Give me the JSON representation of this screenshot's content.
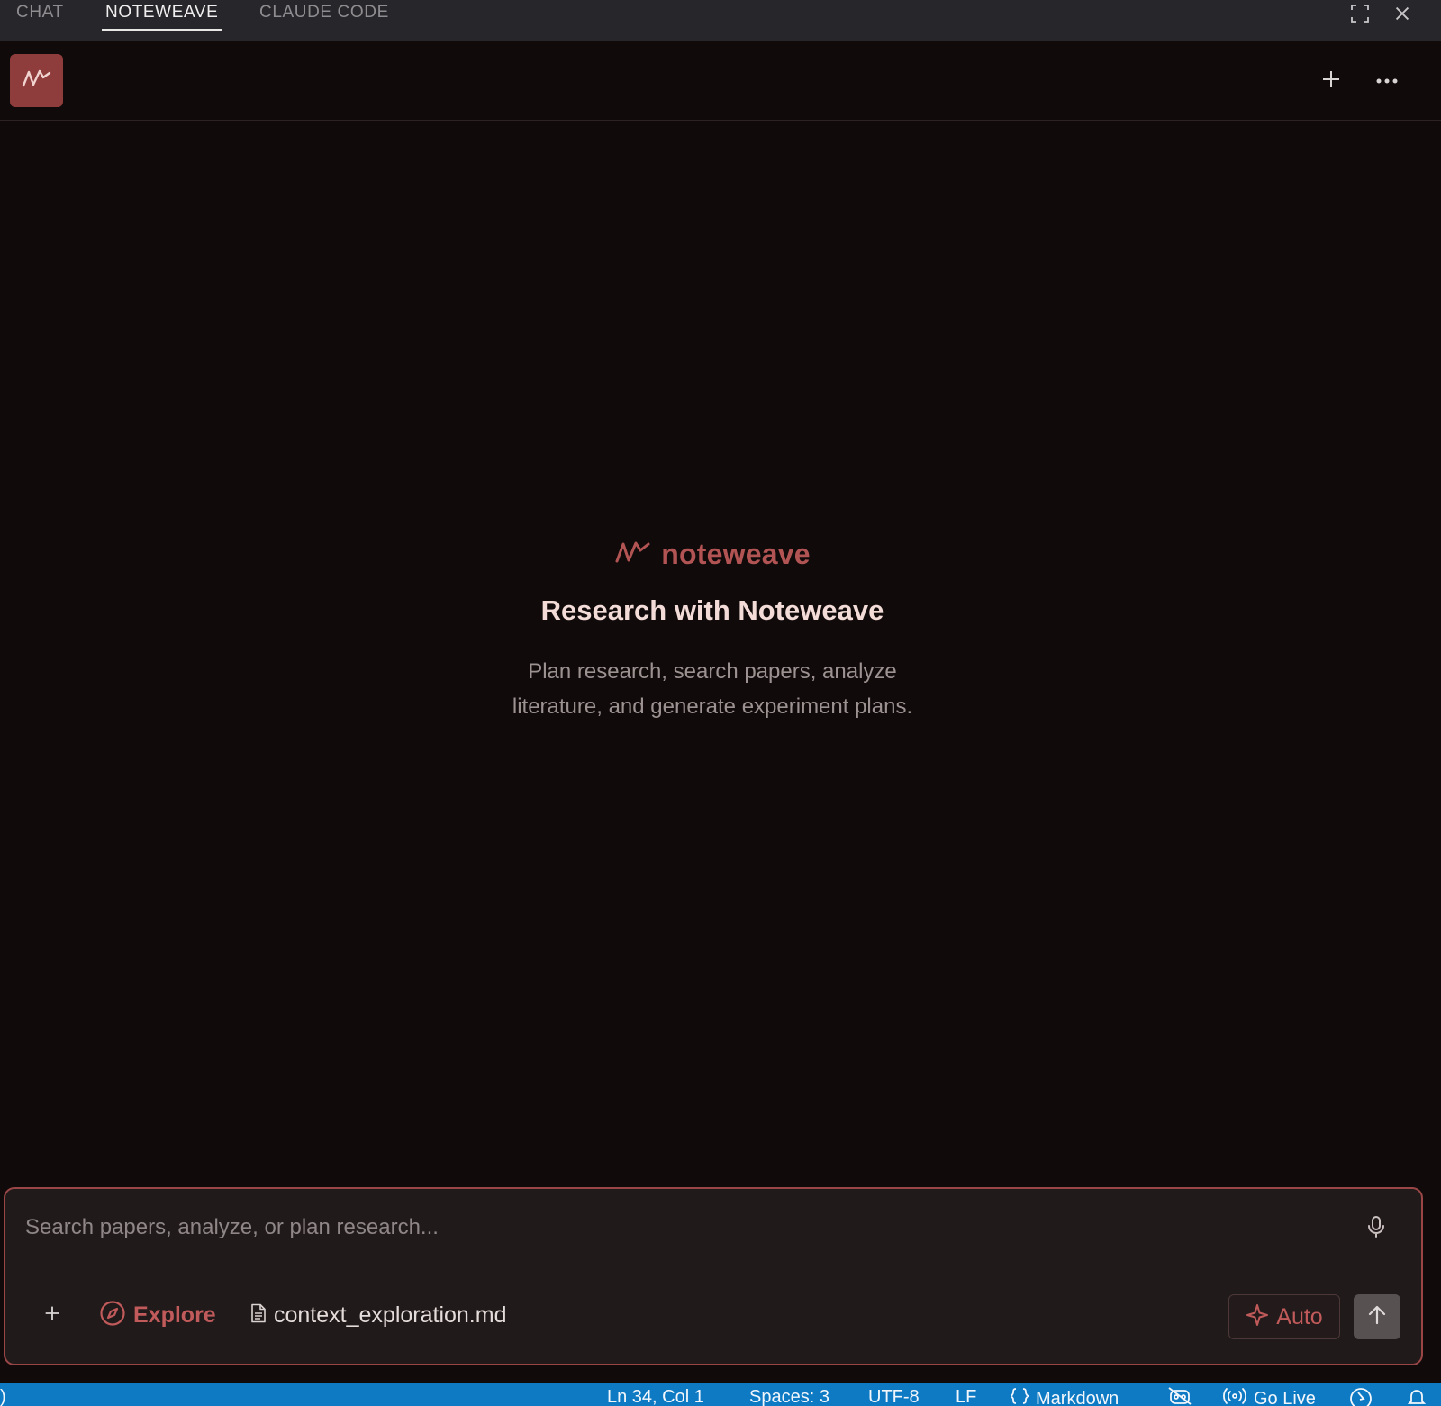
{
  "tabs": [
    {
      "label": "CHAT",
      "active": false
    },
    {
      "label": "NOTEWEAVE",
      "active": true
    },
    {
      "label": "CLAUDE CODE",
      "active": false
    }
  ],
  "window_icons": [
    "maximize-icon",
    "close-icon"
  ],
  "header": {
    "logo_icon": "noteweave-wave-icon",
    "actions": [
      "plus-icon",
      "more-horizontal-icon"
    ]
  },
  "welcome": {
    "brand_name": "noteweave",
    "title": "Research with Noteweave",
    "subtitle": "Plan research, search papers, analyze literature, and generate experiment plans."
  },
  "composer": {
    "placeholder": "Search papers, analyze, or plan research...",
    "explore_label": "Explore",
    "file_label": "context_exploration.md",
    "mode_label": "Auto",
    "icons": [
      "microphone-icon",
      "plus-icon",
      "compass-icon",
      "file-icon",
      "sparkle-icon",
      "arrow-up-icon"
    ]
  },
  "status_bar": {
    "left_fragment": ")",
    "position": "Ln 34, Col 1",
    "spaces": "Spaces: 3",
    "encoding": "UTF-8",
    "eol": "LF",
    "language": "Markdown",
    "go_live": "Go Live"
  },
  "colors": {
    "accent": "#b25454",
    "logo_tile": "#8f3c3c",
    "composer_border": "#9a4646",
    "status_bar": "#0f7ac4",
    "background": "#110a0a"
  }
}
